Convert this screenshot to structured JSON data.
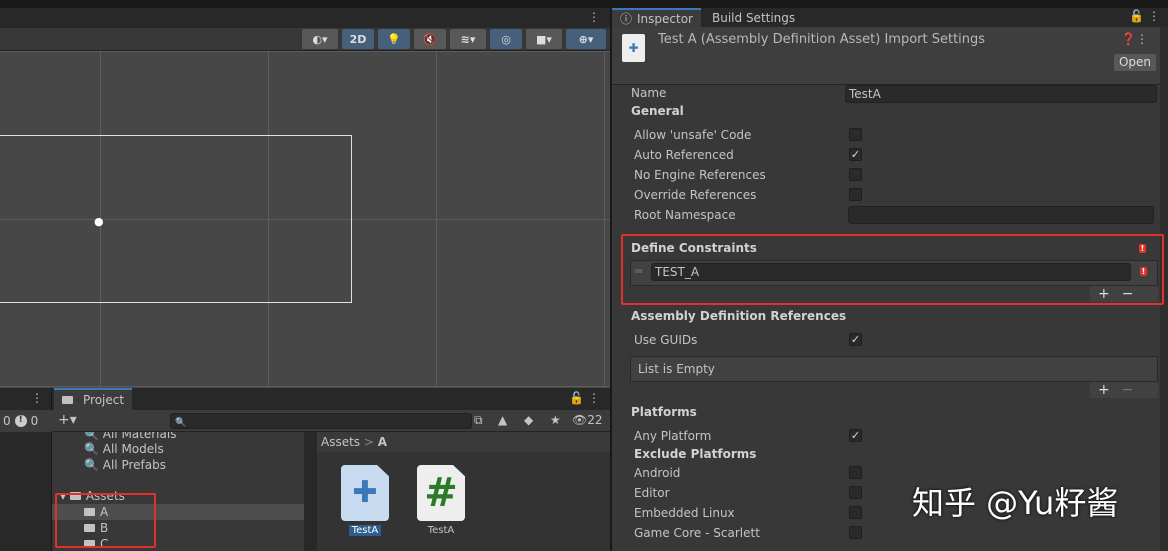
{
  "scene": {
    "toolbar": {
      "mode_2d": "2D"
    }
  },
  "console": {
    "warn_count": "0",
    "error_count": "0"
  },
  "project": {
    "tab": "Project",
    "add_label": "+▾",
    "hidden_count": "22",
    "favorites": [
      "All Materials",
      "All Models",
      "All Prefabs"
    ],
    "assets_root": "Assets",
    "folders": [
      "A",
      "B",
      "C"
    ],
    "breadcrumb": {
      "root": "Assets",
      "sep": ">",
      "current": "A"
    },
    "items": [
      {
        "name": "TestA",
        "icon": "puzzle-icon"
      },
      {
        "name": "TestA",
        "icon": "csharp-icon"
      }
    ]
  },
  "inspector": {
    "tabs": [
      "Inspector",
      "Build Settings"
    ],
    "title": "Test A (Assembly Definition Asset) Import Settings",
    "open": "Open",
    "name_label": "Name",
    "name_value": "TestA",
    "general": "General",
    "general_rows": [
      {
        "label": "Allow 'unsafe' Code",
        "checked": false
      },
      {
        "label": "Auto Referenced",
        "checked": true
      },
      {
        "label": "No Engine References",
        "checked": false
      },
      {
        "label": "Override References",
        "checked": false
      }
    ],
    "root_namespace": "Root Namespace",
    "define_constraints": "Define Constraints",
    "constraint_value": "TEST_A",
    "plus": "+",
    "minus": "−",
    "asm_refs": "Assembly Definition References",
    "use_guids": "Use GUIDs",
    "list_empty": "List is Empty",
    "platforms": "Platforms",
    "any_platform": "Any Platform",
    "exclude": "Exclude Platforms",
    "platform_rows": [
      "Android",
      "Editor",
      "Embedded Linux",
      "Game Core - Scarlett"
    ]
  },
  "watermark": "知乎 @Yu籽酱",
  "checkmark": "✓"
}
